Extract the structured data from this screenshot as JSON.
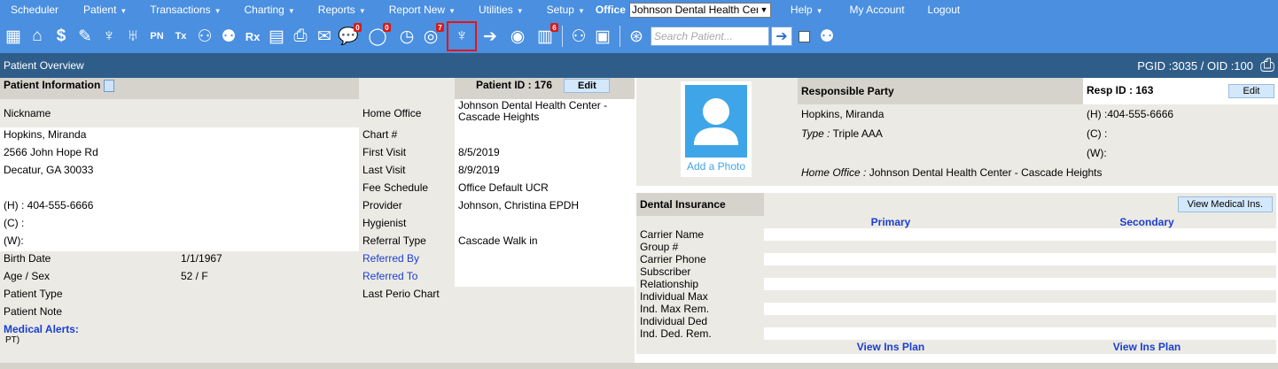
{
  "menu": {
    "items": [
      "Scheduler",
      "Patient",
      "Transactions",
      "Charting",
      "Reports",
      "Report New",
      "Utilities",
      "Setup"
    ],
    "office_label": "Office",
    "office_value": "Johnson Dental Health Cen",
    "right_items": [
      "Help",
      "My Account",
      "Logout"
    ]
  },
  "toolbar": {
    "search_placeholder": "Search Patient...",
    "badges": {
      "messages": "0",
      "chat": "0",
      "globe": "7",
      "notes": "6"
    }
  },
  "overview": {
    "title": "Patient Overview",
    "ids": "PGID :3035  /  OID :100"
  },
  "patient": {
    "header": "Patient Information",
    "id_label": "Patient ID : 176",
    "edit": "Edit",
    "nickname_label": "Nickname",
    "name": "Hopkins, Miranda",
    "street": "2566 John Hope Rd",
    "city": "Decatur, GA 30033",
    "home_phone": "(H) : 404-555-6666",
    "cell_phone": "(C) :",
    "work_phone": "(W):",
    "birth_label": "Birth Date",
    "birth_value": "1/1/1967",
    "age_label": "Age / Sex",
    "age_value": "52 / F",
    "type_label": "Patient Type",
    "note_label": "Patient Note",
    "alerts_label": "Medical Alerts:",
    "alerts_value": "PT)",
    "home_office_label": "Home Office",
    "home_office_value": "Johnson Dental Health Center - Cascade Heights",
    "chart_label": "Chart #",
    "first_visit_label": "First Visit",
    "first_visit_value": "8/5/2019",
    "last_visit_label": "Last Visit",
    "last_visit_value": "8/9/2019",
    "fee_label": "Fee Schedule",
    "fee_value": "Office Default UCR",
    "provider_label": "Provider",
    "provider_value": "Johnson, Christina EPDH",
    "hygienist_label": "Hygienist",
    "referral_type_label": "Referral Type",
    "referral_type_value": "Cascade Walk in",
    "referred_by_label": "Referred By",
    "referred_to_label": "Referred To",
    "perio_label": "Last Perio Chart"
  },
  "responsible": {
    "photo_label": "Add a Photo",
    "header": "Responsible Party",
    "id_label": "Resp ID : 163",
    "edit": "Edit",
    "name": "Hopkins, Miranda",
    "home_phone": "(H) :404-555-6666",
    "type_label": "Type :",
    "type_value": "Triple AAA",
    "cell_phone": "(C) :",
    "work_phone": "(W):",
    "home_office_label": "Home Office :",
    "home_office_value": "Johnson Dental Health Center - Cascade Heights"
  },
  "insurance": {
    "header": "Dental Insurance",
    "view_medical": "View Medical Ins.",
    "primary": "Primary",
    "secondary": "Secondary",
    "rows": [
      "Carrier Name",
      "Group #",
      "Carrier Phone",
      "Subscriber",
      "Relationship",
      "Individual Max",
      "Ind. Max Rem.",
      "Individual Ded",
      "Ind. Ded. Rem."
    ],
    "view_plan": "View Ins Plan"
  }
}
